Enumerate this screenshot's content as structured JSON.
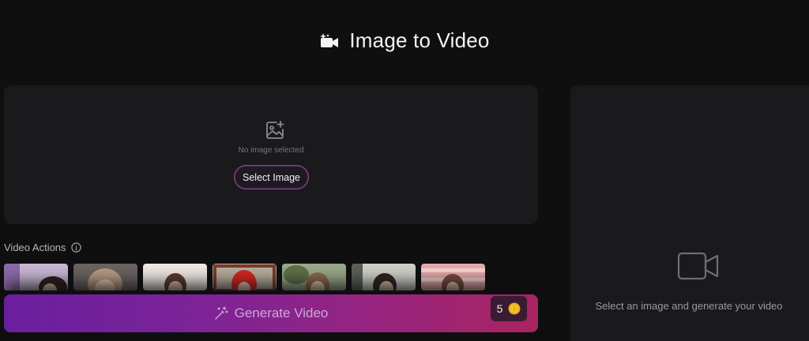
{
  "header": {
    "title": "Image to Video",
    "icon": "video-camera-sparkle-icon"
  },
  "upload": {
    "empty_text": "No image selected",
    "select_button_label": "Select Image",
    "icon": "image-add-icon"
  },
  "video_actions": {
    "label": "Video Actions",
    "info_icon": "info-icon",
    "thumbnails": [
      {
        "name": "action-1"
      },
      {
        "name": "action-2"
      },
      {
        "name": "action-3"
      },
      {
        "name": "action-4"
      },
      {
        "name": "action-5"
      },
      {
        "name": "action-6"
      },
      {
        "name": "action-7"
      }
    ]
  },
  "generate": {
    "label": "Generate Video",
    "icon": "magic-wand-icon",
    "cost": "5",
    "cost_icon": "coin-icon"
  },
  "preview": {
    "empty_text": "Select an image and generate your video",
    "icon": "video-camera-icon"
  },
  "colors": {
    "background": "#0f0f10",
    "panel": "#1a1a1c",
    "accent_start": "#6a1f9e",
    "accent_end": "#a8245f",
    "coin": "#f3c22a"
  }
}
